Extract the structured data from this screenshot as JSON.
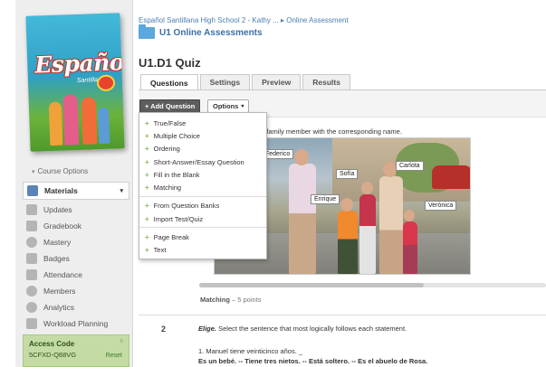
{
  "book": {
    "title": "Español",
    "subtitle": "Santillana"
  },
  "sidebar": {
    "course_options": "Course Options",
    "items": [
      {
        "label": "Materials",
        "icon": "materials-icon",
        "active": true
      },
      {
        "label": "Updates",
        "icon": "updates-icon"
      },
      {
        "label": "Gradebook",
        "icon": "gradebook-icon"
      },
      {
        "label": "Mastery",
        "icon": "mastery-icon"
      },
      {
        "label": "Badges",
        "icon": "badges-icon"
      },
      {
        "label": "Attendance",
        "icon": "attendance-icon"
      },
      {
        "label": "Members",
        "icon": "members-icon"
      },
      {
        "label": "Analytics",
        "icon": "analytics-icon"
      },
      {
        "label": "Workload Planning",
        "icon": "workload-icon"
      }
    ],
    "access": {
      "label": "Access Code",
      "code": "5CFXD-Q88VG",
      "reset": "Reset",
      "close": "x"
    }
  },
  "breadcrumb": "Español Santillana High School 2 - Kathy ... ▸ Online Assessment",
  "section_title": "U1 Online Assessments",
  "quiz_title": "U1.D1 Quiz",
  "tabs": [
    "Questions",
    "Settings",
    "Preview",
    "Results"
  ],
  "toolbar": {
    "add_question": "+ Add Question",
    "options": "Options"
  },
  "menu": {
    "group1": [
      "True/False",
      "Multiple Choice",
      "Ordering",
      "Short-Answer/Essay Question",
      "Fill in the Blank",
      "Matching"
    ],
    "group2": [
      "From Question Banks",
      "Import Test/Quiz"
    ],
    "group3": [
      "Page Break",
      "Text"
    ]
  },
  "question1": {
    "instruction": "h family member with the corresponding name.",
    "labels": [
      "Federico",
      "Sofía",
      "Carlota",
      "Enrique",
      "Verónica"
    ],
    "type_label": "Matching",
    "points": " – 5 points"
  },
  "question2": {
    "number": "2",
    "instruction_bold": "Elige.",
    "instruction": " Select the sentence that most logically follows each statement.",
    "item": "1. Manuel tiene veinticinco años. _",
    "choices": "Es un bebé. -- Tiene tres nietos. -- Está soltero. -- Es el abuelo de Rosa."
  },
  "colors": {
    "accent_blue": "#3a6fa8",
    "access_green": "#c4dca3",
    "add_button": "#5d5d5d"
  }
}
